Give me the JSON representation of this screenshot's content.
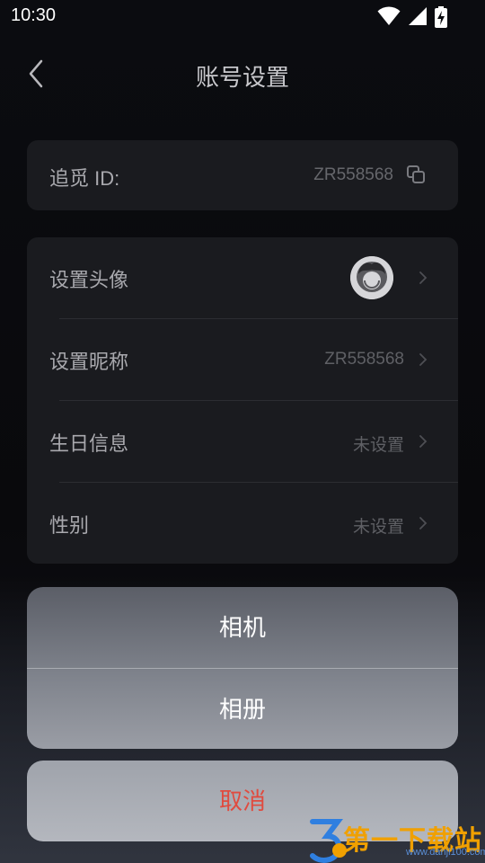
{
  "status_bar": {
    "time": "10:30",
    "icons": [
      "wifi-icon",
      "signal-icon",
      "battery-charging-icon"
    ]
  },
  "nav": {
    "title": "账号设置",
    "back_icon": "chevron-left-icon"
  },
  "id_card": {
    "label": "追觅 ID:",
    "value": "ZR558568",
    "copy_icon": "copy-icon"
  },
  "settings": {
    "items": [
      {
        "label": "设置头像",
        "value": "",
        "icon": "avatar"
      },
      {
        "label": "设置昵称",
        "value": "ZR558568"
      },
      {
        "label": "生日信息",
        "value": "未设置"
      },
      {
        "label": "性别",
        "value": "未设置"
      }
    ]
  },
  "action_sheet": {
    "options": [
      "相机",
      "相册"
    ],
    "cancel": "取消",
    "cancel_color": "#e04b3f"
  },
  "watermark": {
    "text": "第一下载站",
    "url": "www.danji100.com"
  }
}
